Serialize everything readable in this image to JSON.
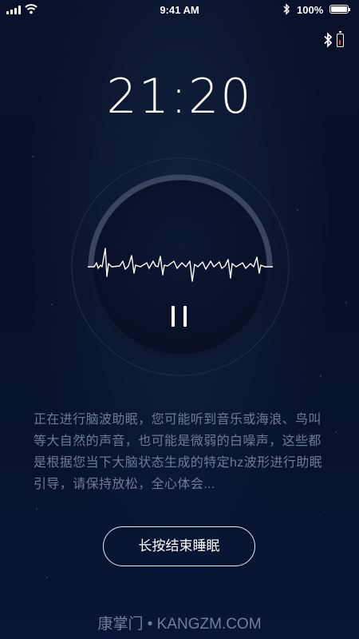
{
  "status_bar": {
    "time": "9:41 AM",
    "battery_percent": "100%"
  },
  "device": {
    "bluetooth_icon": "bluetooth-icon",
    "battery_icon": "low-battery-icon",
    "battery_alert_color": "#ff3b30"
  },
  "session": {
    "timer": "21:20",
    "state": "playing",
    "pause_icon": "pause-icon"
  },
  "description": "正在进行脑波助眠，您可能听到音乐或海浪、鸟叫等大自然的声音，也可能是微弱的白噪声，这些都是根据您当下大脑状态生成的特定hz波形进行助眠引导，请保持放松，全心体会...",
  "actions": {
    "end_label": "长按结束睡眠"
  },
  "watermark": "康掌门 • KANGZM.COM",
  "colors": {
    "background": "#071026",
    "text_primary": "#ffffff",
    "text_secondary": "#6f7a96",
    "ring_track": "#3a4660"
  }
}
